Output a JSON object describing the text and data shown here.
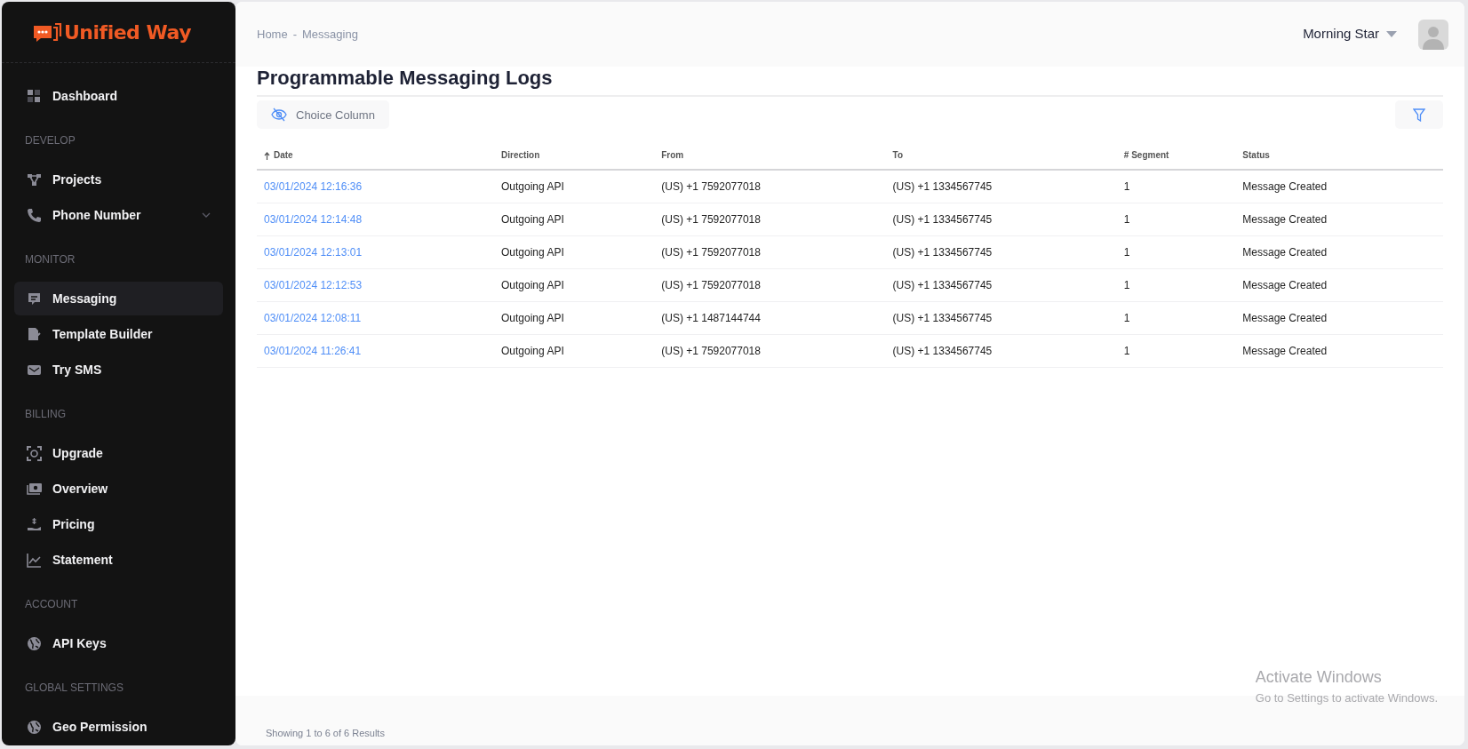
{
  "brand": {
    "name": "Unified Way"
  },
  "sidebar": {
    "sections": [
      {
        "items": [
          {
            "label": "Dashboard",
            "selected": false,
            "has_submenu": false
          }
        ]
      },
      {
        "heading": "DEVELOP",
        "items": [
          {
            "label": "Projects",
            "selected": false,
            "has_submenu": false
          },
          {
            "label": "Phone Number",
            "selected": false,
            "has_submenu": true
          }
        ]
      },
      {
        "heading": "MONITOR",
        "items": [
          {
            "label": "Messaging",
            "selected": true,
            "has_submenu": false
          },
          {
            "label": "Template Builder",
            "selected": false,
            "has_submenu": false
          },
          {
            "label": "Try SMS",
            "selected": false,
            "has_submenu": false
          }
        ]
      },
      {
        "heading": "BILLING",
        "items": [
          {
            "label": "Upgrade",
            "selected": false,
            "has_submenu": false
          },
          {
            "label": "Overview",
            "selected": false,
            "has_submenu": false
          },
          {
            "label": "Pricing",
            "selected": false,
            "has_submenu": false
          },
          {
            "label": "Statement",
            "selected": false,
            "has_submenu": false
          }
        ]
      },
      {
        "heading": "ACCOUNT",
        "items": [
          {
            "label": "API Keys",
            "selected": false,
            "has_submenu": false
          }
        ]
      },
      {
        "heading": "GLOBAL SETTINGS",
        "items": [
          {
            "label": "Geo Permission",
            "selected": false,
            "has_submenu": false
          }
        ]
      }
    ]
  },
  "breadcrumb": [
    "Home",
    "Messaging"
  ],
  "breadcrumb_separator": "-",
  "user": {
    "name": "Morning Star"
  },
  "page_title": "Programmable Messaging Logs",
  "toolbar": {
    "column_button": "Choice Column"
  },
  "table": {
    "columns": [
      {
        "label": "Date",
        "sorted": true
      },
      {
        "label": "Direction",
        "sorted": false
      },
      {
        "label": "From",
        "sorted": false
      },
      {
        "label": "To",
        "sorted": false
      },
      {
        "label": "# Segment",
        "sorted": false
      },
      {
        "label": "Status",
        "sorted": false
      }
    ],
    "rows": [
      [
        "03/01/2024 12:16:36",
        "Outgoing API",
        "(US) +1 7592077018",
        "(US) +1 1334567745",
        "1",
        "Message Created"
      ],
      [
        "03/01/2024 12:14:48",
        "Outgoing API",
        "(US) +1 7592077018",
        "(US) +1 1334567745",
        "1",
        "Message Created"
      ],
      [
        "03/01/2024 12:13:01",
        "Outgoing API",
        "(US) +1 7592077018",
        "(US) +1 1334567745",
        "1",
        "Message Created"
      ],
      [
        "03/01/2024 12:12:53",
        "Outgoing API",
        "(US) +1 7592077018",
        "(US) +1 1334567745",
        "1",
        "Message Created"
      ],
      [
        "03/01/2024 12:08:11",
        "Outgoing API",
        "(US) +1 1487144744",
        "(US) +1 1334567745",
        "1",
        "Message Created"
      ],
      [
        "03/01/2024 11:26:41",
        "Outgoing API",
        "(US) +1 7592077018",
        "(US) +1 1334567745",
        "1",
        "Message Created"
      ]
    ]
  },
  "footer": "Showing 1 to 6 of 6 Results",
  "os_notice": {
    "title": "Activate Windows",
    "subtitle": "Go to Settings to activate Windows."
  }
}
